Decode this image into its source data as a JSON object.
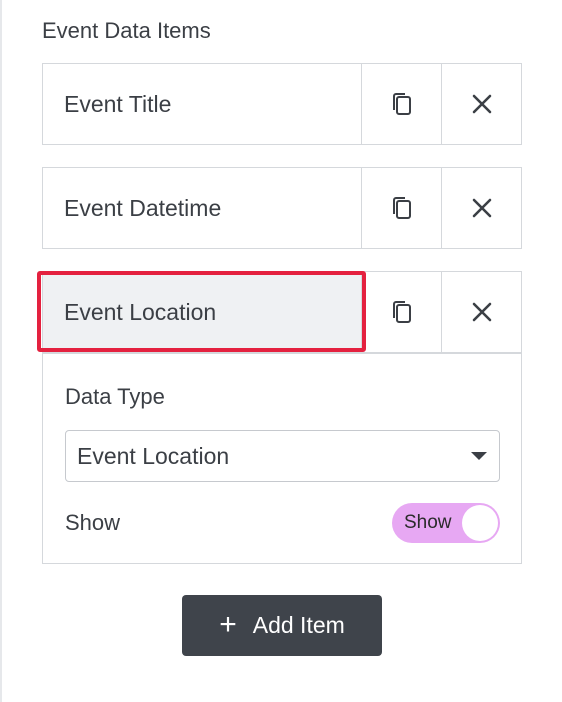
{
  "section": {
    "label": "Event Data Items"
  },
  "items": [
    {
      "label": "Event Title"
    },
    {
      "label": "Event Datetime"
    },
    {
      "label": "Event Location"
    }
  ],
  "icons": {
    "duplicate": "copy-icon",
    "remove": "close-icon",
    "dropdown": "caret-down-icon",
    "add": "plus-icon"
  },
  "panel": {
    "data_type_label": "Data Type",
    "data_type_value": "Event Location",
    "show_label": "Show",
    "toggle_text": "Show"
  },
  "add_button": {
    "plus": "+",
    "label": "Add Item"
  },
  "colors": {
    "highlight": "#e4213f",
    "toggle_on": "#e7a8f3",
    "button_bg": "#3f444b"
  }
}
